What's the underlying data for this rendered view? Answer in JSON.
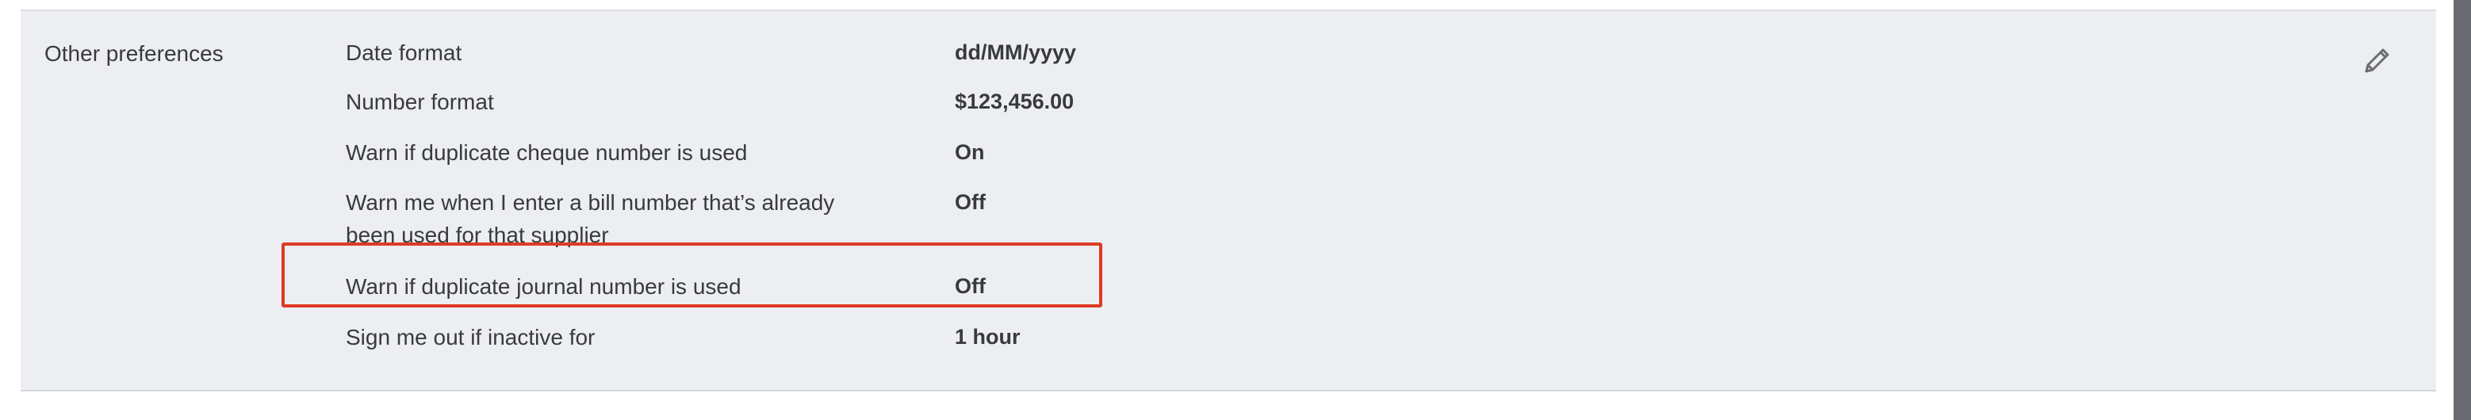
{
  "section": {
    "title": "Other preferences"
  },
  "rows": [
    {
      "label": "Date format",
      "value": "dd/MM/yyyy"
    },
    {
      "label": "Number format",
      "value": "$123,456.00"
    },
    {
      "label": "Warn if duplicate cheque number is used",
      "value": "On"
    },
    {
      "label": "Warn me when I enter a bill number that’s already been used for that supplier",
      "value": "Off"
    },
    {
      "label": "Warn if duplicate journal number is used",
      "value": "Off"
    },
    {
      "label": "Sign me out if inactive for",
      "value": "1 hour"
    }
  ],
  "icons": {
    "edit": "pencil-icon"
  },
  "colors": {
    "panel_background": "#eceef1",
    "highlight_border": "#de3a24",
    "text": "#393a3d"
  }
}
